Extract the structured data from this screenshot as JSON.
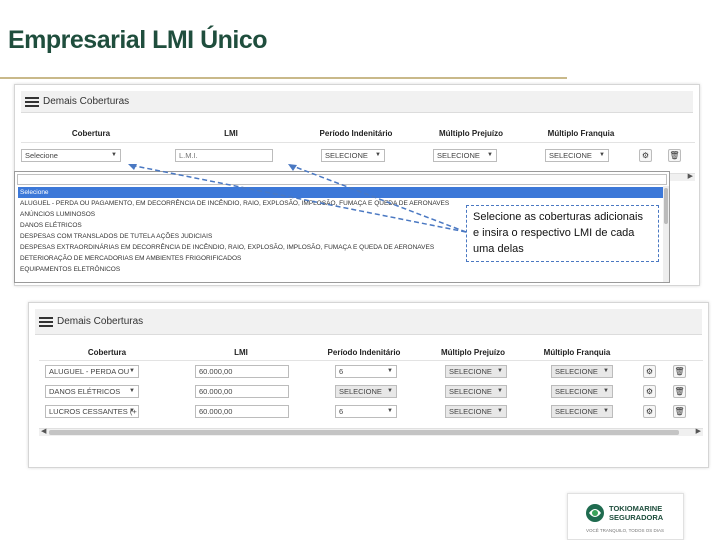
{
  "slide": {
    "title": "Empresarial LMI Único"
  },
  "panel_top": {
    "title": "Demais Coberturas",
    "columns": [
      "Cobertura",
      "LMI",
      "Período Indenitário",
      "Múltiplo Prejuízo",
      "Múltiplo Franquia"
    ],
    "row": {
      "cobertura": "Selecione",
      "lmi_placeholder": "L.M.I.",
      "periodo": "SELECIONE",
      "prejuizo": "SELECIONE",
      "franquia": "SELECIONE"
    }
  },
  "dropdown": {
    "items": [
      "Selecione",
      "ALUGUEL - PERDA OU PAGAMENTO, EM DECORRÊNCIA DE INCÊNDIO, RAIO, EXPLOSÃO, IMPLOSÃO, FUMAÇA E QUEDA DE AERONAVES",
      "ANÚNCIOS LUMINOSOS",
      "DANOS ELÉTRICOS",
      "DESPESAS COM TRANSLADOS DE TUTELA AÇÕES JUDICIAIS",
      "DESPESAS EXTRAORDINÁRIAS EM DECORRÊNCIA DE INCÊNDIO, RAIO, EXPLOSÃO, IMPLOSÃO, FUMAÇA E QUEDA DE AERONAVES",
      "DETERIORAÇÃO DE MERCADORIAS EM AMBIENTES FRIGORIFICADOS",
      "EQUIPAMENTOS ELETRÔNICOS"
    ],
    "selected_index": 0
  },
  "callout": {
    "text": "Selecione as coberturas adicionais e insira o respectivo LMI de cada uma delas"
  },
  "panel_bottom": {
    "title": "Demais Coberturas",
    "columns": [
      "Cobertura",
      "LMI",
      "Período Indenitário",
      "Múltiplo Prejuízo",
      "Múltiplo Franquia"
    ],
    "rows": [
      {
        "cobertura": "ALUGUEL - PERDA OU",
        "lmi": "60.000,00",
        "periodo": "6",
        "prejuizo": "SELECIONE",
        "franquia": "SELECIONE"
      },
      {
        "cobertura": "DANOS ELÉTRICOS",
        "lmi": "60.000,00",
        "periodo": "SELECIONE",
        "prejuizo": "SELECIONE",
        "franquia": "SELECIONE"
      },
      {
        "cobertura": "LUCROS CESSANTES (+",
        "lmi": "60.000,00",
        "periodo": "6",
        "prejuizo": "SELECIONE",
        "franquia": "SELECIONE"
      }
    ]
  },
  "logo": {
    "line1": "TOKIOMARINE",
    "line2": "SEGURADORA",
    "tagline": "VOCÊ TRANQUILO, TODOS OS DIAS"
  },
  "icons": {
    "row_action": "gear-icon",
    "row_delete": "trash-icon"
  }
}
